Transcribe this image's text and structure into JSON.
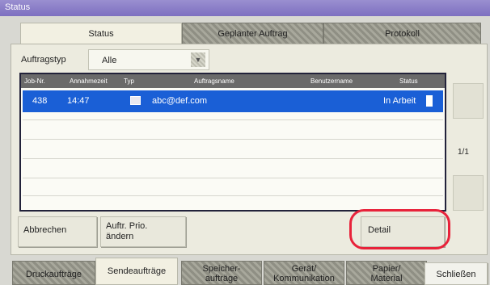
{
  "titlebar": {
    "title": "Status"
  },
  "tabs": [
    {
      "label": "Status"
    },
    {
      "label": "Geplanter Auftrag"
    },
    {
      "label": "Protokoll"
    }
  ],
  "filter": {
    "label": "Auftragstyp",
    "value": "Alle"
  },
  "table": {
    "columns": [
      "Job-Nr.",
      "Annahmezeit",
      "Typ",
      "Auftragsname",
      "Benutzername",
      "Status"
    ],
    "rows": [
      {
        "job_nr": "438",
        "time": "14:47",
        "type_icon": "send-icon",
        "name": "abc@def.com",
        "user": "",
        "status": "In Arbeit"
      }
    ]
  },
  "pagination": {
    "page": "1/1"
  },
  "buttons": {
    "cancel": "Abbrechen",
    "prio_line1": "Auftr. Prio.",
    "prio_line2": "ändern",
    "detail": "Detail"
  },
  "bottom_tabs": [
    {
      "line1": "Druckaufträge",
      "line2": ""
    },
    {
      "line1": "Sendeaufträge",
      "line2": ""
    },
    {
      "line1": "Speicher-",
      "line2": "aufträge"
    },
    {
      "line1": "Gerät/",
      "line2": "Kommunikation"
    },
    {
      "line1": "Papier/",
      "line2": "Material"
    }
  ],
  "close_label": "Schließen",
  "colors": {
    "selected_row": "#1a5fd6",
    "highlight": "#e8223a",
    "titlebar": "#8a7fc8"
  }
}
